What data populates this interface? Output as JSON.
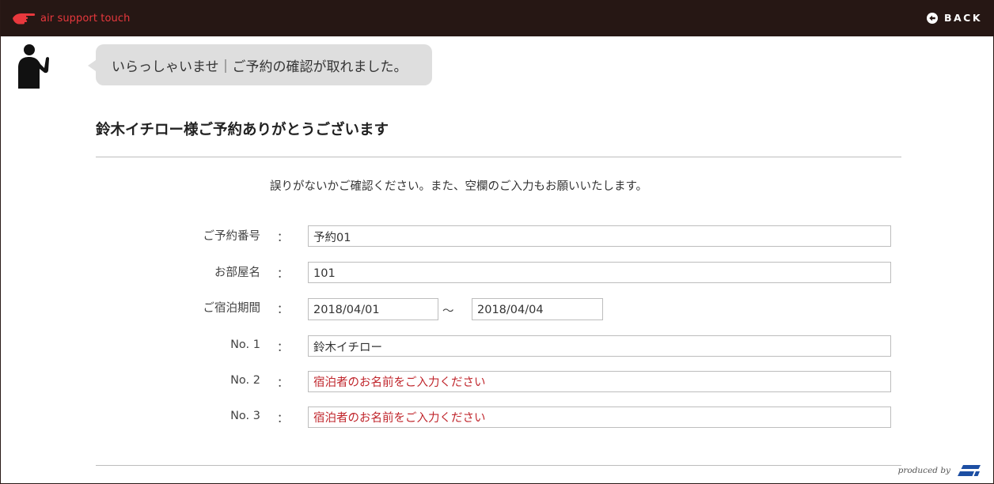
{
  "app": {
    "name": "air support touch"
  },
  "header": {
    "back_label": "BACK"
  },
  "bubble": {
    "message": "いらっしゃいませ｜ご予約の確認が取れました。"
  },
  "main": {
    "heading": "鈴木イチロー様ご予約ありがとうございます",
    "note": "誤りがないかご確認ください。また、空欄のご入力もお願いいたします。"
  },
  "form": {
    "colon": "：",
    "reservation_number": {
      "label": "ご予約番号",
      "value": "予約01"
    },
    "room_name": {
      "label": "お部屋名",
      "value": "101"
    },
    "stay_period": {
      "label": "ご宿泊期間",
      "from": "2018/04/01",
      "separator": "〜",
      "to": "2018/04/04"
    },
    "guests": [
      {
        "label": "No. 1",
        "value": "鈴木イチロー",
        "placeholder": ""
      },
      {
        "label": "No. 2",
        "value": "",
        "placeholder": "宿泊者のお名前をご入力ください"
      },
      {
        "label": "No. 3",
        "value": "",
        "placeholder": "宿泊者のお名前をご入力ください"
      }
    ]
  },
  "footer": {
    "produced_by": "produced by"
  },
  "colors": {
    "topbar": "#261714",
    "brand_red": "#e8383d",
    "placeholder_red": "#c0262c",
    "bubble": "#dedede",
    "maker_blue": "#1d4fa3"
  },
  "icons": {
    "logo": "pointing-hand-icon",
    "back": "back-arrow-circle-icon",
    "avatar": "concierge-person-icon",
    "maker": "maker-logo"
  }
}
